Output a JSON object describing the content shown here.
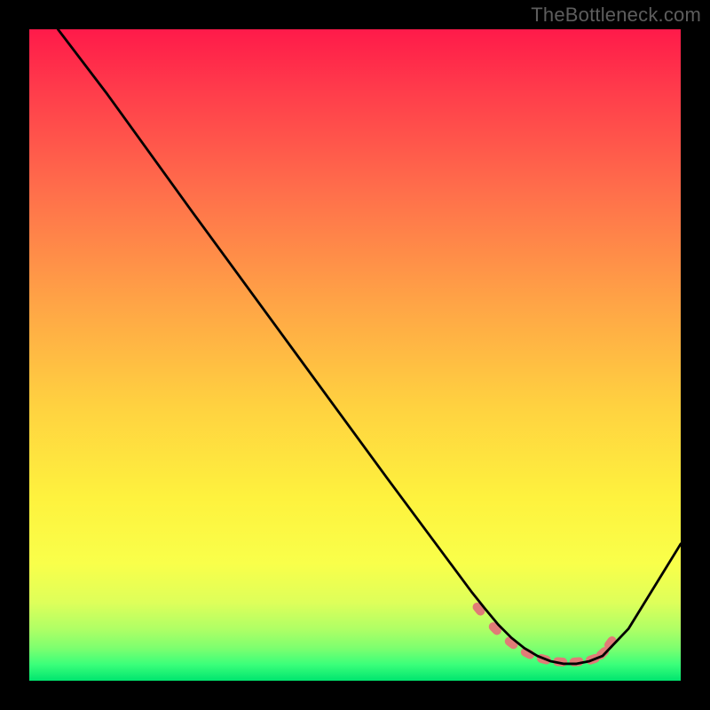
{
  "watermark": "TheBottleneck.com",
  "chart_data": {
    "type": "line",
    "title": "",
    "xlabel": "",
    "ylabel": "",
    "xlim": [
      0,
      100
    ],
    "ylim": [
      0,
      100
    ],
    "grid": false,
    "legend": false,
    "series": [
      {
        "name": "curve",
        "color": "#000000",
        "x": [
          4.4,
          12,
          25,
          40,
          55,
          68,
          70,
          72,
          74,
          76,
          78,
          80,
          82,
          84,
          86,
          88,
          92,
          100
        ],
        "y": [
          100,
          90,
          72,
          51.5,
          31,
          13.5,
          11,
          8.6,
          6.6,
          5,
          3.8,
          3,
          2.6,
          2.6,
          3,
          3.8,
          8,
          21
        ]
      }
    ],
    "markers": {
      "name": "dotted-region",
      "color": "#e07b77",
      "shape": "rounded-dash",
      "x": [
        69,
        71.5,
        74,
        76.5,
        79,
        81.5,
        84,
        86.5,
        88,
        89.2
      ],
      "y": [
        11,
        8,
        5.8,
        4.2,
        3.3,
        2.9,
        2.9,
        3.3,
        4.2,
        5.8
      ]
    },
    "gradient_stops": [
      {
        "pos": 0.0,
        "color": "#ff1a4a"
      },
      {
        "pos": 0.1,
        "color": "#ff3e4b"
      },
      {
        "pos": 0.25,
        "color": "#ff6f4b"
      },
      {
        "pos": 0.42,
        "color": "#ffa446"
      },
      {
        "pos": 0.58,
        "color": "#ffd240"
      },
      {
        "pos": 0.72,
        "color": "#fef23e"
      },
      {
        "pos": 0.82,
        "color": "#f9ff4a"
      },
      {
        "pos": 0.88,
        "color": "#deff5a"
      },
      {
        "pos": 0.92,
        "color": "#b0ff65"
      },
      {
        "pos": 0.95,
        "color": "#7dff6f"
      },
      {
        "pos": 0.975,
        "color": "#3bff7a"
      },
      {
        "pos": 1.0,
        "color": "#00e56f"
      }
    ]
  }
}
